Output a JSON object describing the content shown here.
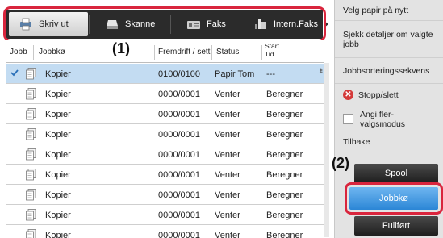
{
  "tabs": [
    {
      "label": "Skriv ut",
      "active": true,
      "icon": "printer-icon"
    },
    {
      "label": "Skanne",
      "active": false,
      "icon": "scanner-icon"
    },
    {
      "label": "Faks",
      "active": false,
      "icon": "fax-icon"
    },
    {
      "label": "Intern.Faks",
      "active": false,
      "icon": "internet-fax-icon"
    }
  ],
  "callouts": {
    "one": "(1)",
    "two": "(2)"
  },
  "columns": {
    "jobb": "Jobb",
    "jobbko": "Jobbkø",
    "fremdrift": "Fremdrift / sett",
    "status": "Status",
    "start_line1": "Start",
    "start_line2": "Tid"
  },
  "rows": [
    {
      "name": "Kopier",
      "progress": "0100/0100",
      "status": "Papir Tom",
      "start": "---",
      "selected": true
    },
    {
      "name": "Kopier",
      "progress": "0000/0001",
      "status": "Venter",
      "start": "Beregner",
      "selected": false
    },
    {
      "name": "Kopier",
      "progress": "0000/0001",
      "status": "Venter",
      "start": "Beregner",
      "selected": false
    },
    {
      "name": "Kopier",
      "progress": "0000/0001",
      "status": "Venter",
      "start": "Beregner",
      "selected": false
    },
    {
      "name": "Kopier",
      "progress": "0000/0001",
      "status": "Venter",
      "start": "Beregner",
      "selected": false
    },
    {
      "name": "Kopier",
      "progress": "0000/0001",
      "status": "Venter",
      "start": "Beregner",
      "selected": false
    },
    {
      "name": "Kopier",
      "progress": "0000/0001",
      "status": "Venter",
      "start": "Beregner",
      "selected": false
    },
    {
      "name": "Kopier",
      "progress": "0000/0001",
      "status": "Venter",
      "start": "Beregner",
      "selected": false
    },
    {
      "name": "Kopier",
      "progress": "0000/0001",
      "status": "Venter",
      "start": "Beregner",
      "selected": false
    }
  ],
  "menu": {
    "velg_papir": "Velg papir på nytt",
    "sjekk": "Sjekk detaljer om valgte jobb",
    "sortering": "Jobbsorteringssekvens",
    "stopp": "Stopp/slett",
    "fler": "Angi fler-valgsmodus",
    "tilbake": "Tilbake"
  },
  "buttons": {
    "spool": "Spool",
    "jobbko": "Jobbkø",
    "fullfort": "Fullført"
  },
  "colors": {
    "highlight": "#d9253d",
    "selected_row": "#c3dcf2",
    "active_button": "#2b86d6"
  }
}
